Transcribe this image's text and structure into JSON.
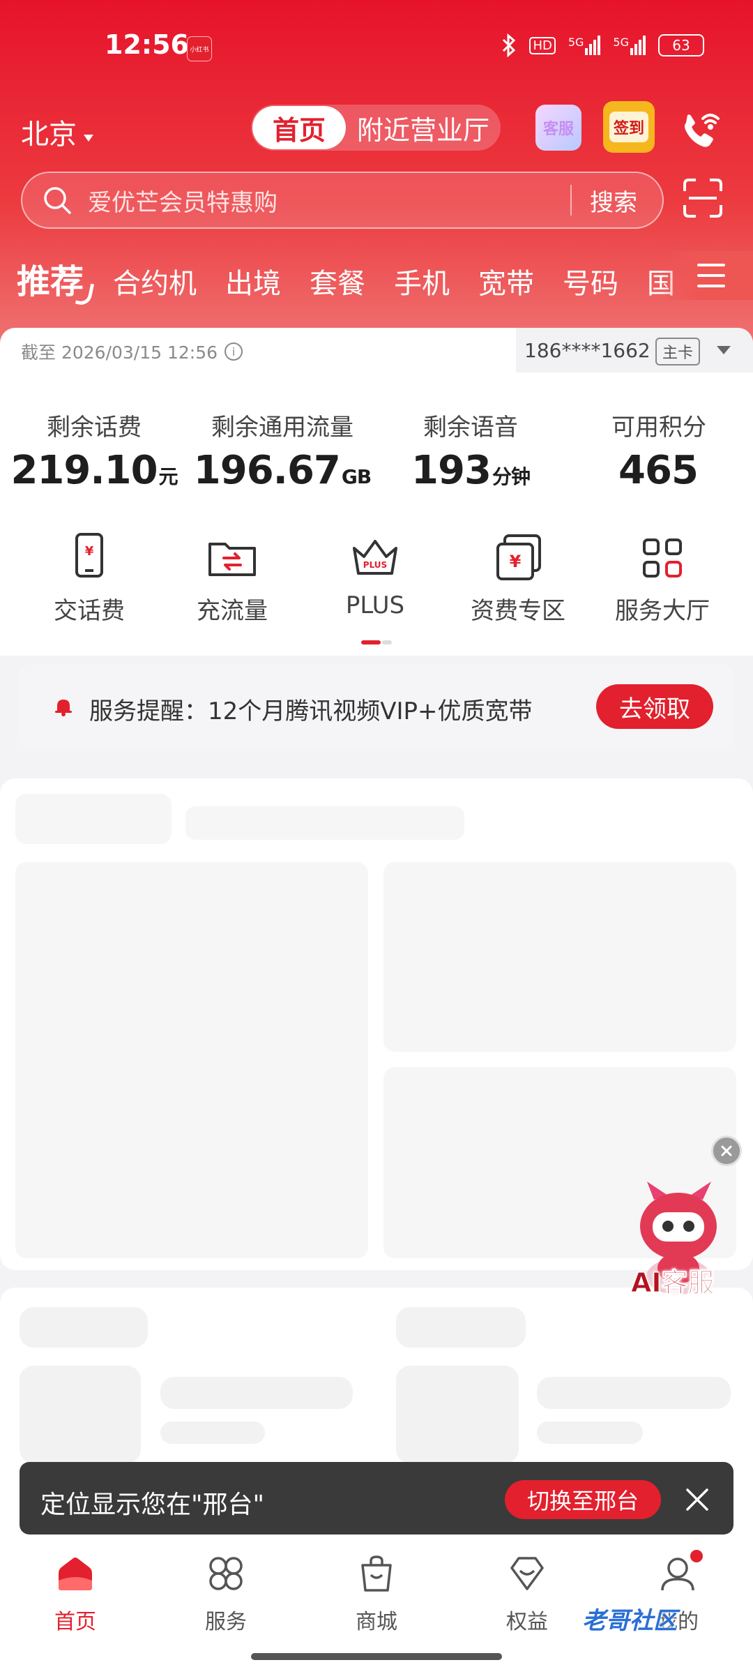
{
  "status_bar": {
    "time": "12:56",
    "app_badge": "小红书",
    "hd_label": "HD",
    "net1": "5G",
    "net2": "5G",
    "battery": "63"
  },
  "header": {
    "city": "北京",
    "seg_active": "首页",
    "seg_inactive": "附近营业厅",
    "kefu_label": "客服",
    "qiandao_label": "签到"
  },
  "search": {
    "placeholder": "爱优芒会员特惠购",
    "button": "搜索"
  },
  "tabs": {
    "recommend": "推荐",
    "items": [
      "合约机",
      "出境",
      "套餐",
      "手机",
      "宽带",
      "号码",
      "国"
    ]
  },
  "account": {
    "as_of": "截至 2026/03/15 12:56",
    "phone": "186****1662",
    "card_type": "主卡",
    "stats": [
      {
        "label": "剩余话费",
        "value": "219.10",
        "unit": "元"
      },
      {
        "label": "剩余通用流量",
        "value": "196.67",
        "unit": "GB"
      },
      {
        "label": "剩余语音",
        "value": "193",
        "unit": "分钟"
      },
      {
        "label": "可用积分",
        "value": "465",
        "unit": ""
      }
    ]
  },
  "quick_actions": [
    {
      "label": "交话费",
      "icon": "phone-bill-icon"
    },
    {
      "label": "充流量",
      "icon": "data-topup-icon"
    },
    {
      "label": "PLUS",
      "icon": "plus-crown-icon"
    },
    {
      "label": "资费专区",
      "icon": "tariff-zone-icon"
    },
    {
      "label": "服务大厅",
      "icon": "service-hall-icon"
    }
  ],
  "notice": {
    "text": "服务提醒：12个月腾讯视频VIP+优质宽带",
    "button": "去领取"
  },
  "ai_service": {
    "label": "AI客服"
  },
  "toast": {
    "text": "定位显示您在\"邢台\"",
    "button": "切换至邢台"
  },
  "bottom_nav": [
    {
      "label": "首页",
      "icon": "home-icon",
      "active": true
    },
    {
      "label": "服务",
      "icon": "services-icon",
      "active": false
    },
    {
      "label": "商城",
      "icon": "shopping-bag-icon",
      "active": false
    },
    {
      "label": "权益",
      "icon": "benefits-icon",
      "active": false
    },
    {
      "label": "我的",
      "icon": "profile-icon",
      "active": false
    }
  ],
  "watermark": "老哥社区",
  "colors": {
    "brand_red": "#e3202d",
    "header_top": "#e6132b",
    "header_bottom": "#f07a78"
  }
}
